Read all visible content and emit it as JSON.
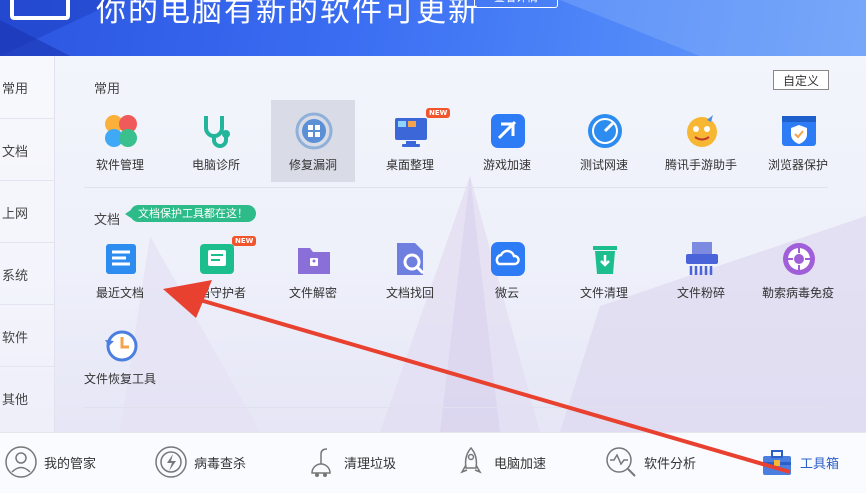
{
  "banner": {
    "title": "你的电脑有新的软件可更新",
    "detail_button": "查看详情"
  },
  "sidebar": {
    "items": [
      {
        "label": "常用"
      },
      {
        "label": "文档"
      },
      {
        "label": "上网"
      },
      {
        "label": "系统"
      },
      {
        "label": "软件"
      },
      {
        "label": "其他"
      }
    ]
  },
  "section_common": {
    "title": "常用",
    "customize_label": "自定义",
    "tools": [
      {
        "label": "软件管理"
      },
      {
        "label": "电脑诊所"
      },
      {
        "label": "修复漏洞"
      },
      {
        "label": "桌面整理",
        "badge": "NEW"
      },
      {
        "label": "游戏加速"
      },
      {
        "label": "测试网速"
      },
      {
        "label": "腾讯手游助手"
      },
      {
        "label": "浏览器保护"
      }
    ]
  },
  "section_docs": {
    "title": "文档",
    "tip": "文档保护工具都在这！",
    "tools": [
      {
        "label": "最近文档"
      },
      {
        "label": "文档守护者",
        "badge": "NEW"
      },
      {
        "label": "文件解密"
      },
      {
        "label": "文档找回"
      },
      {
        "label": "微云"
      },
      {
        "label": "文件清理"
      },
      {
        "label": "文件粉碎"
      },
      {
        "label": "勒索病毒免疫"
      },
      {
        "label": "文件恢复工具"
      }
    ]
  },
  "bottom_nav": {
    "items": [
      {
        "label": "我的管家"
      },
      {
        "label": "病毒查杀"
      },
      {
        "label": "清理垃圾"
      },
      {
        "label": "电脑加速"
      },
      {
        "label": "软件分析"
      },
      {
        "label": "工具箱"
      }
    ]
  },
  "colors": {
    "accent": "#2d7cf5",
    "banner": "#3a6df2",
    "arrow": "#e8412f",
    "badge": "#f2542b",
    "tip": "#2dbb8a"
  }
}
